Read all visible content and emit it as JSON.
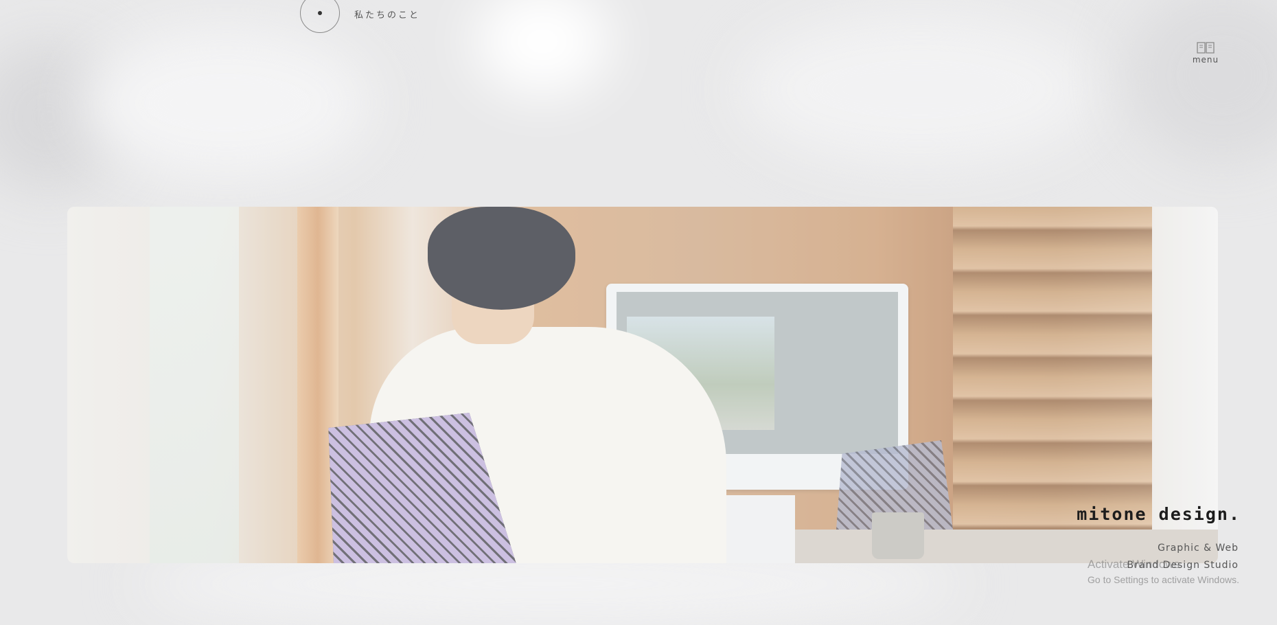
{
  "nav": {
    "about_label": "私たちのこと",
    "menu_label": "menu"
  },
  "hero": {
    "image_description_icon": "photo-woman-at-computer"
  },
  "brand": {
    "title": "mitone design.",
    "line1": "Graphic & Web",
    "line2": "Brand Design Studio"
  },
  "watermark": {
    "title": "Activate Windows",
    "subtitle": "Go to Settings to activate Windows."
  },
  "colors": {
    "background": "#e9e9ea",
    "text": "#555555",
    "brand": "#1c1c1c"
  }
}
